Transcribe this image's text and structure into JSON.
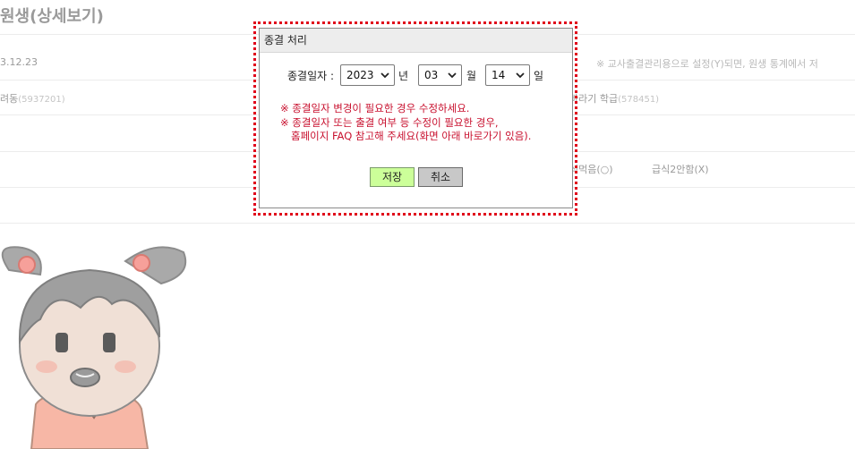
{
  "background": {
    "title": "원생(상세보기)",
    "row1_left": "3.12.23",
    "row1_right": "※ 교사출결관리용으로 설정(Y)되면, 원생 통계에서 저",
    "row2_left": "려동",
    "row2_left_code": "(5937201)",
    "row2_right": "바라기 학급",
    "row2_right_code": "(578451)",
    "row4_meal_yes": "식먹음(○)",
    "row4_meal_no": "급식2안함(X)"
  },
  "dialog": {
    "title": "종결 처리",
    "date_label": "종결일자 :",
    "year_value": "2023",
    "year_unit": "년",
    "month_value": "03",
    "month_unit": "월",
    "day_value": "14",
    "day_unit": "일",
    "notes": [
      "※ 종결일자 변경이 필요한 경우 수정하세요.",
      "※ 종결일자 또는 출결 여부 등 수정이 필요한 경우,",
      "홈페이지 FAQ 참고해 주세요(화면 아래 바로가기 있음)."
    ],
    "save_label": "저장",
    "cancel_label": "취소"
  },
  "colors": {
    "notice_red": "#c8102e",
    "frame_red": "#e0001a",
    "save_green": "#ccff99",
    "cancel_gray": "#c8c8c8"
  },
  "icons": [
    "chevron-down-icon",
    "girl-mascot-illustration"
  ]
}
